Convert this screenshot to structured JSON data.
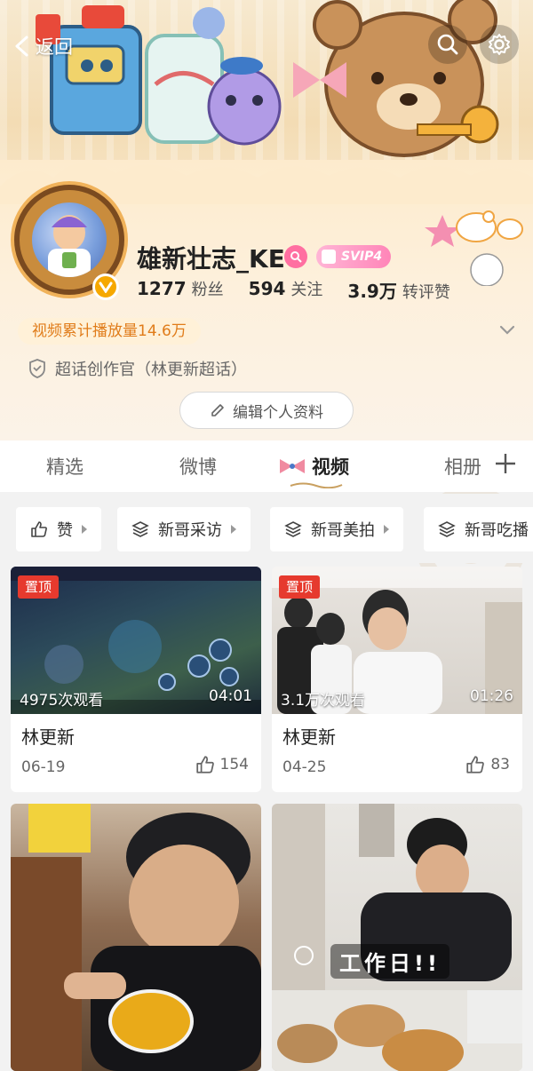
{
  "header": {
    "back_label": "返回"
  },
  "profile": {
    "username": "雄新壮志_KE",
    "vip_badge": "SVIP4",
    "stats": [
      {
        "value": "1277",
        "label": "粉丝"
      },
      {
        "value": "594",
        "label": "关注"
      },
      {
        "value": "3.9万",
        "label": "转评赞"
      }
    ],
    "plays_summary": "视频累计播放量14.6万",
    "super_topic": "超话创作官（林更新超话）",
    "edit_button": "编辑个人资料"
  },
  "tabs": [
    {
      "label": "精选",
      "active": false
    },
    {
      "label": "微博",
      "active": false
    },
    {
      "label": "视频",
      "active": true
    },
    {
      "label": "相册",
      "active": false
    }
  ],
  "filter_chips": [
    {
      "label": "赞",
      "icon": "thumbs-up-icon"
    },
    {
      "label": "新哥采访",
      "icon": "layers-icon"
    },
    {
      "label": "新哥美拍",
      "icon": "layers-icon"
    },
    {
      "label": "新哥吃播",
      "icon": "layers-icon"
    }
  ],
  "videos": [
    {
      "pinned": true,
      "pin_label": "置顶",
      "views": "4975次观看",
      "duration": "04:01",
      "title": "林更新",
      "date": "06-19",
      "likes": "154"
    },
    {
      "pinned": true,
      "pin_label": "置顶",
      "views": "3.1万次观看",
      "duration": "01:26",
      "title": "林更新",
      "date": "04-25",
      "likes": "83"
    },
    {
      "pinned": false
    },
    {
      "pinned": false,
      "overlay_text": "工作日!!"
    }
  ],
  "colors": {
    "accent_orange": "#e07c1a",
    "pin_red": "#e63a2e",
    "svip_pink": "#ff85b8"
  }
}
